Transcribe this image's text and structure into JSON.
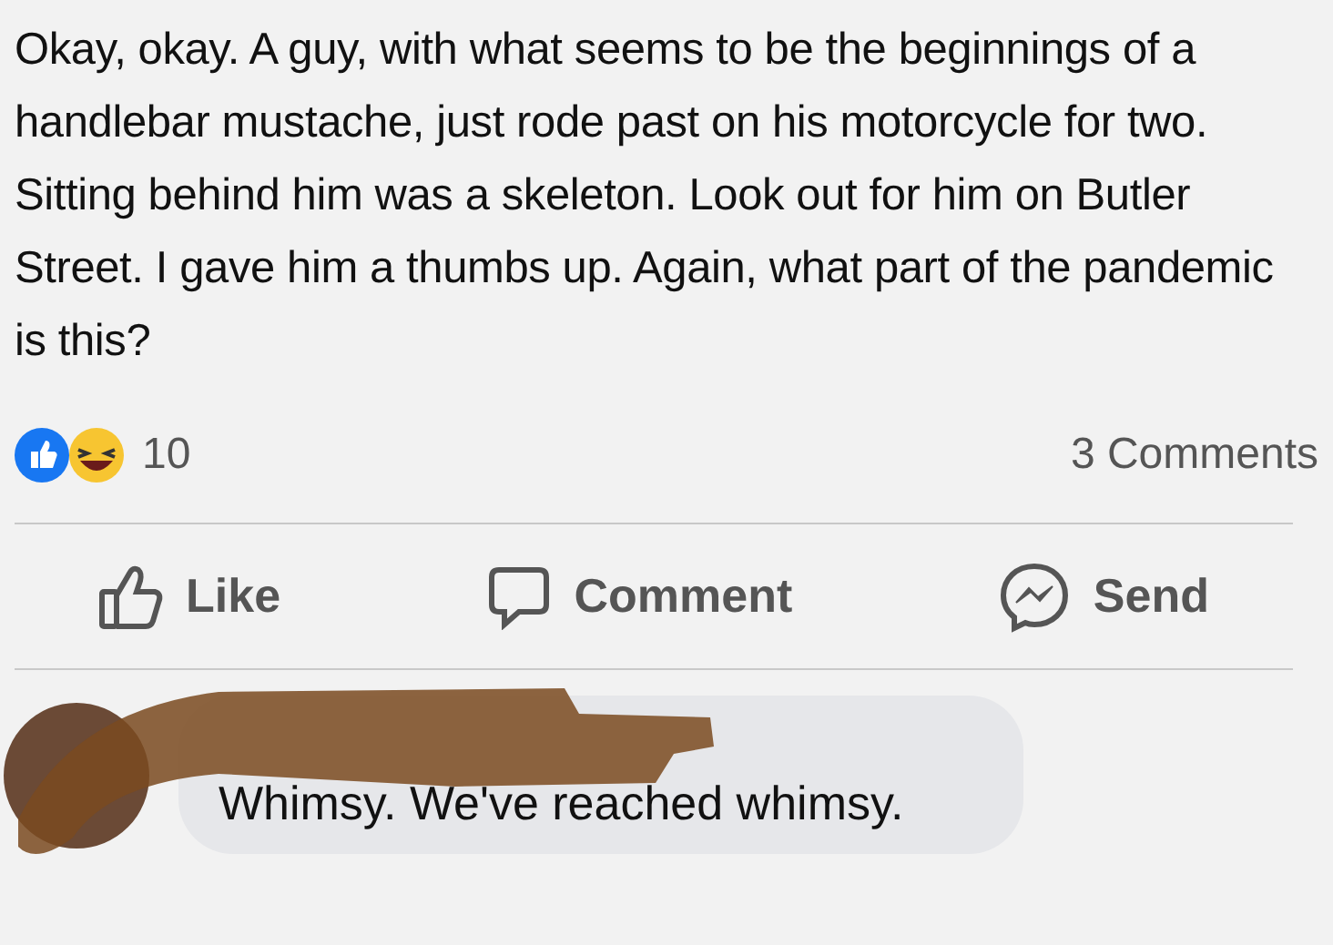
{
  "post": {
    "text": "Okay, okay. A guy, with what seems to be the beginnings of a handlebar mustache, just rode past on his motorcycle for two. Sitting behind him was a skeleton. Look out for him on Butler Street. I gave him a thumbs up. Again, what part of the pandemic is this?"
  },
  "reactions": {
    "count": "10",
    "comments": "3 Comments"
  },
  "actions": [
    {
      "kind": "like",
      "label": "Like"
    },
    {
      "kind": "comment",
      "label": "Comment"
    },
    {
      "kind": "send",
      "label": "Send"
    }
  ],
  "comment": {
    "text": "Whimsy. We've reached whimsy."
  }
}
